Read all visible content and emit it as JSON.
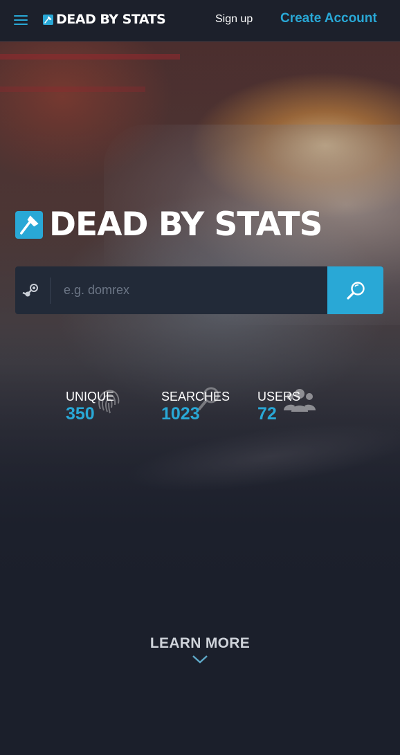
{
  "navbar": {
    "brand": "DEAD BY STATS",
    "signup": "Sign up",
    "create_account": "Create Account"
  },
  "hero": {
    "title": "DEAD BY STATS",
    "search": {
      "placeholder": "e.g. domrex",
      "value": ""
    }
  },
  "stats": [
    {
      "label": "UNIQUE",
      "value": "350",
      "icon": "fingerprint-icon"
    },
    {
      "label": "SEARCHES",
      "value": "1023",
      "icon": "magnifier-icon"
    },
    {
      "label": "USERS",
      "value": "72",
      "icon": "users-icon"
    }
  ],
  "learn_more": "LEARN MORE",
  "colors": {
    "accent": "#29a8d6",
    "background": "#1b1f2b",
    "search_bg": "#222a38"
  }
}
